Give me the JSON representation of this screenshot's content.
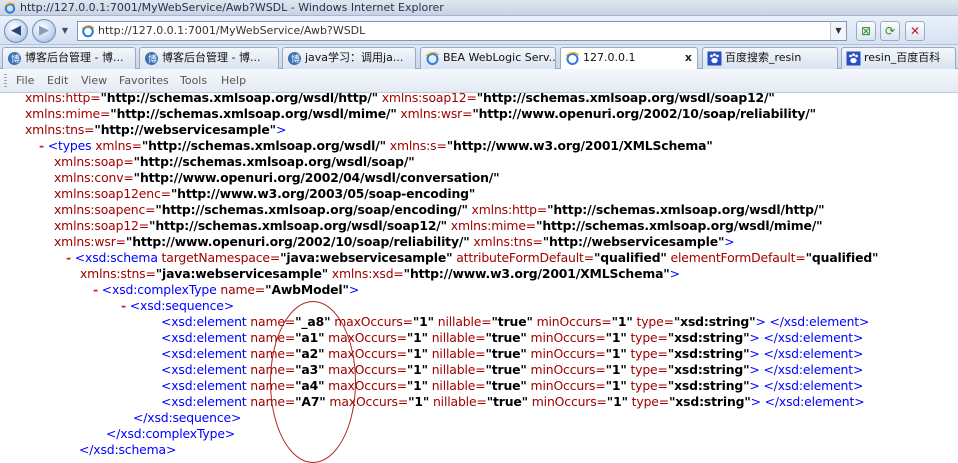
{
  "window": {
    "title": "http://127.0.0.1:7001/MyWebService/Awb?WSDL - Windows Internet Explorer"
  },
  "address_bar": {
    "url": "http://127.0.0.1:7001/MyWebService/Awb?WSDL"
  },
  "tabs": [
    {
      "label": "博客后台管理 - 博..."
    },
    {
      "label": "博客后台管理 - 博..."
    },
    {
      "label": "java学习：调用ja..."
    },
    {
      "label": "BEA WebLogic Serv..."
    },
    {
      "label": "127.0.0.1",
      "active": true,
      "close": "x"
    },
    {
      "label": "百度搜索_resin"
    },
    {
      "label": "resin_百度百科"
    }
  ],
  "menu": {
    "items": [
      "File",
      "Edit",
      "View",
      "Favorites",
      "Tools",
      "Help"
    ]
  },
  "xml": {
    "l1": {
      "a1": "xmlns:http=",
      "v1": "\"http://schemas.xmlsoap.org/wsdl/http/\"",
      "a2": " xmlns:soap12=",
      "v2": "\"http://schemas.xmlsoap.org/wsdl/soap12/\""
    },
    "l2": {
      "a1": "xmlns:mime=",
      "v1": "\"http://schemas.xmlsoap.org/wsdl/mime/\"",
      "a2": " xmlns:wsr=",
      "v2": "\"http://www.openuri.org/2002/10/soap/reliability/\""
    },
    "l3": {
      "a1": "xmlns:tns=",
      "v1": "\"http://webservicesample\"",
      "end": ">"
    },
    "l4": {
      "dash": "-",
      "tag": " <types",
      "a1": " xmlns=",
      "v1": "\"http://schemas.xmlsoap.org/wsdl/\"",
      "a2": " xmlns:s=",
      "v2": "\"http://www.w3.org/2001/XMLSchema\""
    },
    "l5": {
      "a1": "xmlns:soap=",
      "v1": "\"http://schemas.xmlsoap.org/wsdl/soap/\""
    },
    "l6": {
      "a1": "xmlns:conv=",
      "v1": "\"http://www.openuri.org/2002/04/wsdl/conversation/\""
    },
    "l7": {
      "a1": "xmlns:soap12enc=",
      "v1": "\"http://www.w3.org/2003/05/soap-encoding\""
    },
    "l8": {
      "a1": "xmlns:soapenc=",
      "v1": "\"http://schemas.xmlsoap.org/soap/encoding/\"",
      "a2": " xmlns:http=",
      "v2": "\"http://schemas.xmlsoap.org/wsdl/http/\""
    },
    "l9": {
      "a1": "xmlns:soap12=",
      "v1": "\"http://schemas.xmlsoap.org/wsdl/soap12/\"",
      "a2": " xmlns:mime=",
      "v2": "\"http://schemas.xmlsoap.org/wsdl/mime/\""
    },
    "l10": {
      "a1": "xmlns:wsr=",
      "v1": "\"http://www.openuri.org/2002/10/soap/reliability/\"",
      "a2": " xmlns:tns=",
      "v2": "\"http://webservicesample\"",
      "end": ">"
    },
    "l11": {
      "dash": "-",
      "tag": " <xsd:schema",
      "a1": " targetNamespace=",
      "v1": "\"java:webservicesample\"",
      "a2": " attributeFormDefault=",
      "v2": "\"qualified\"",
      "a3": " elementFormDefault=",
      "v3": "\"qualified\""
    },
    "l12": {
      "a1": "xmlns:stns=",
      "v1": "\"java:webservicesample\"",
      "a2": " xmlns:xsd=",
      "v2": "\"http://www.w3.org/2001/XMLSchema\"",
      "end": ">"
    },
    "l13": {
      "dash": "-",
      "tag": " <xsd:complexType",
      "a1": " name=",
      "v1": "\"AwbModel\"",
      "end": ">"
    },
    "l14": {
      "dash": "-",
      "tag": " <xsd:sequence>"
    },
    "elements": [
      {
        "name": "\"_a8\""
      },
      {
        "name": "\"a1\""
      },
      {
        "name": "\"a2\""
      },
      {
        "name": "\"a3\""
      },
      {
        "name": "\"a4\""
      },
      {
        "name": "\"A7\""
      }
    ],
    "el": {
      "open": "<xsd:element",
      "name_attr": " name=",
      "max_attr": " maxOccurs=",
      "max_val": "\"1\"",
      "nil_attr": " nillable=",
      "nil_val": "\"true\"",
      "min_attr": " minOccurs=",
      "min_val": "\"1\"",
      "type_attr": " type=",
      "type_val": "\"xsd:string\"",
      "close": "> </xsd:element>"
    },
    "l21": {
      "tag": "</xsd:sequence>"
    },
    "l22": {
      "tag": "</xsd:complexType>"
    },
    "l23": {
      "tag": "</xsd:schema>"
    }
  },
  "colors": {
    "tag": "#0000ff",
    "attribute": "#a00000",
    "dash": "#d02020",
    "annotation_ellipse": "#b32020"
  }
}
